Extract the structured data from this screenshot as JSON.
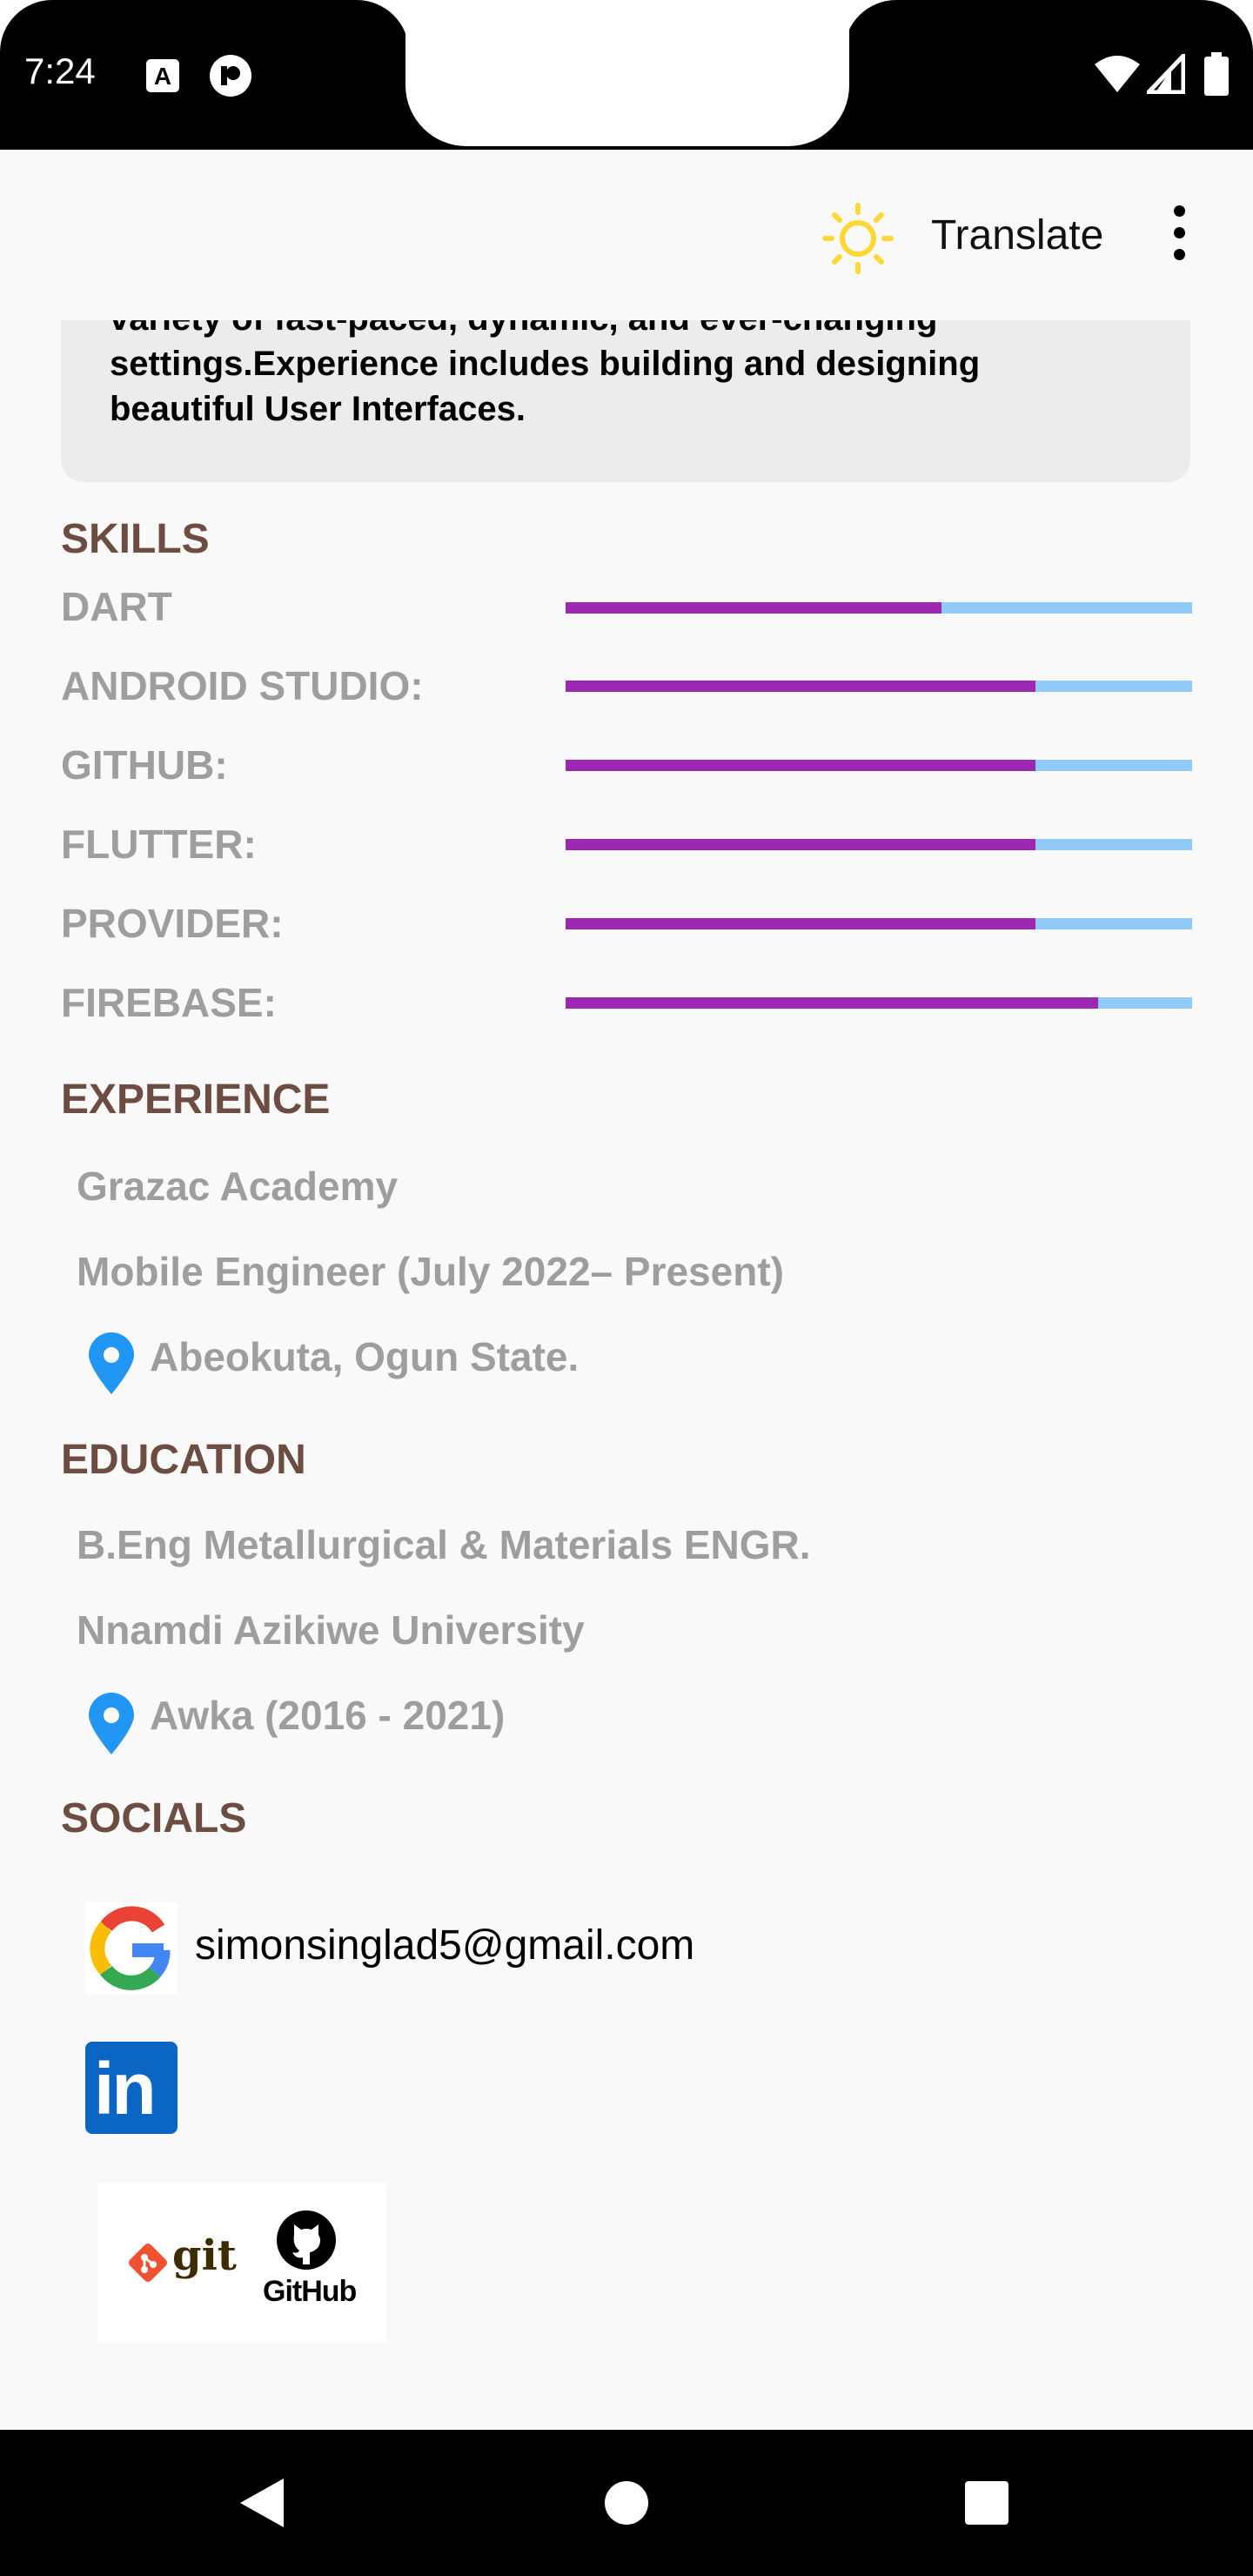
{
  "status_bar": {
    "time": "7:24",
    "icons": [
      "a-notification-icon",
      "app-notification-icon",
      "wifi-icon",
      "cell-signal-icon",
      "battery-icon"
    ]
  },
  "app_bar": {
    "theme_icon": "sun-icon",
    "translate_label": "Translate",
    "menu_icon": "more-vert-icon"
  },
  "summary": {
    "lines": [
      "variety of fast-paced, dynamic, and ever-changing",
      "settings.Experience includes building and designing",
      "beautiful User Interfaces."
    ]
  },
  "skills": {
    "heading": "SKILLS",
    "items": [
      {
        "label": "DART",
        "level": 0.6
      },
      {
        "label": "ANDROID STUDIO:",
        "level": 0.75
      },
      {
        "label": "GITHUB:",
        "level": 0.75
      },
      {
        "label": "FLUTTER:",
        "level": 0.75
      },
      {
        "label": "PROVIDER:",
        "level": 0.75
      },
      {
        "label": "FIREBASE:",
        "level": 0.85
      }
    ]
  },
  "experience": {
    "heading": "EXPERIENCE",
    "company": "Grazac Academy",
    "role": "Mobile Engineer (July 2022– Present)",
    "location": "Abeokuta, Ogun State."
  },
  "education": {
    "heading": "EDUCATION",
    "degree": "B.Eng Metallurgical & Materials ENGR.",
    "school": "Nnamdi Azikiwe University",
    "location": "Awka (2016 - 2021)"
  },
  "socials": {
    "heading": "SOCIALS",
    "email": "simonsinglad5@gmail.com",
    "git_label": "git",
    "github_label": "GitHub",
    "linkedin_label": "in"
  },
  "colors": {
    "heading": "#6d4c41",
    "muted_text": "#9e9e9e",
    "bar_fill": "#9c27b0",
    "bar_track": "#90caf9",
    "pin": "#2196f3",
    "sun": "#fdd835",
    "linkedin": "#0a66c2"
  }
}
